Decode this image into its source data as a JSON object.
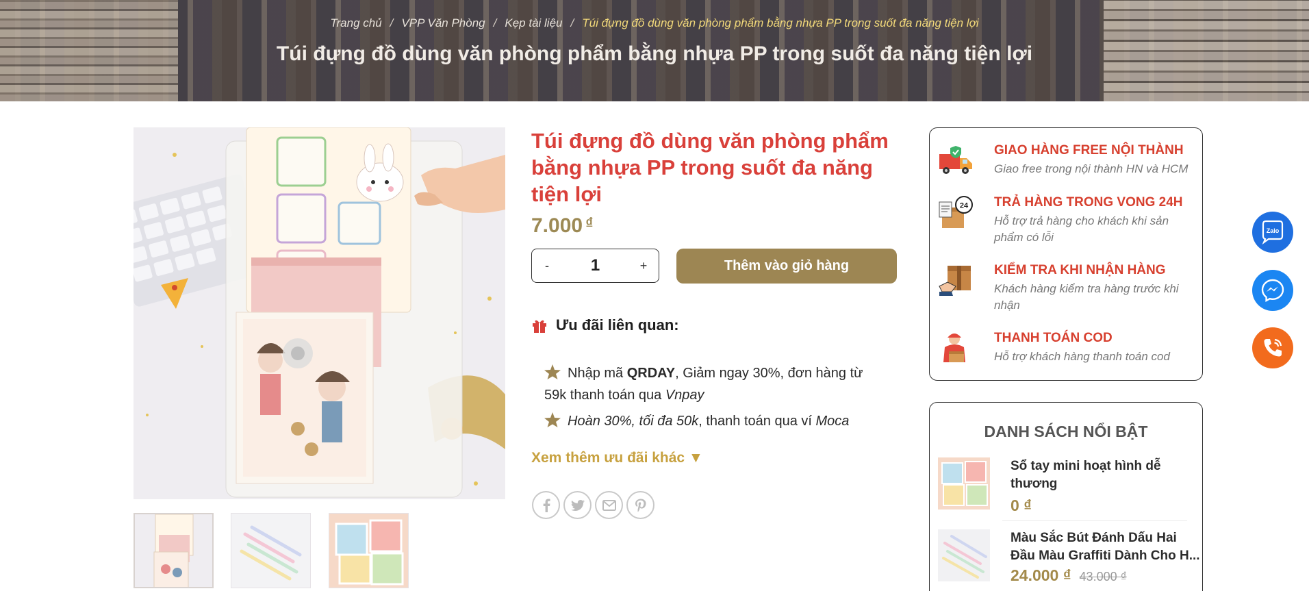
{
  "breadcrumb": {
    "items": [
      "Trang chủ",
      "VPP Văn Phòng",
      "Kẹp tài liệu"
    ],
    "current": "Túi đựng đồ dùng văn phòng phẩm bằng nhựa PP trong suốt đa năng tiện lợi"
  },
  "hero": {
    "title": "Túi đựng đồ dùng văn phòng phẩm bằng nhựa PP trong suốt đa năng tiện lợi"
  },
  "product": {
    "title": "Túi đựng đồ dùng văn phòng phẩm bằng nhựa PP trong suốt đa năng tiện lợi",
    "price": "7.000",
    "currency": "₫",
    "quantity": "1",
    "minus": "-",
    "plus": "+",
    "add_to_cart": "Thêm vào giỏ hàng"
  },
  "promo": {
    "heading": "Ưu đãi liên quan:",
    "item1": {
      "prefix": "Nhập mã ",
      "code": "QRDAY",
      "middle": ", Giảm ngay 30%, đơn hàng từ 59k thanh toán qua ",
      "method": "Vnpay"
    },
    "item2": {
      "emph": "Hoàn 30%, tối đa 50k",
      "middle": ", thanh toán qua ví ",
      "wallet": "Moca"
    },
    "more": "Xem thêm ưu đãi khác ▼"
  },
  "benefits": [
    {
      "title": "GIAO HÀNG FREE NỘI THÀNH",
      "desc": "Giao free trong nội thành HN và HCM",
      "icon": "delivery-truck-icon"
    },
    {
      "title": "TRẢ HÀNG TRONG VONG 24H",
      "desc": "Hỗ trợ trả hàng cho khách khi sản phẩm có lỗi",
      "icon": "return-24h-icon"
    },
    {
      "title": "KIỂM TRA KHI NHẬN HÀNG",
      "desc": "Khách hàng kiểm tra hàng trước khi nhận",
      "icon": "check-package-icon"
    },
    {
      "title": "THANH TOÁN COD",
      "desc": "Hỗ trợ khách hàng thanh toán cod",
      "icon": "cod-courier-icon"
    }
  ],
  "featured": {
    "title": "DANH SÁCH NỔI BẬT",
    "items": [
      {
        "name": "Sổ tay mini hoạt hình dễ thương",
        "price": "0 ₫",
        "old_price": ""
      },
      {
        "name": "Màu Sắc Bút Đánh Dấu Hai Đầu Màu Graffiti Dành Cho H...",
        "price": "24.000 ₫",
        "old_price": "43.000 ₫"
      }
    ]
  },
  "floating": {
    "zalo_label": "Zalo"
  },
  "colors": {
    "accent_red": "#d9403a",
    "gold": "#9d8653",
    "price_gold": "#9d8a55",
    "link_gold": "#c7a13f",
    "zalo_blue": "#1f6fe0",
    "messenger_blue": "#1b86f2",
    "phone_orange": "#f26b1d"
  }
}
